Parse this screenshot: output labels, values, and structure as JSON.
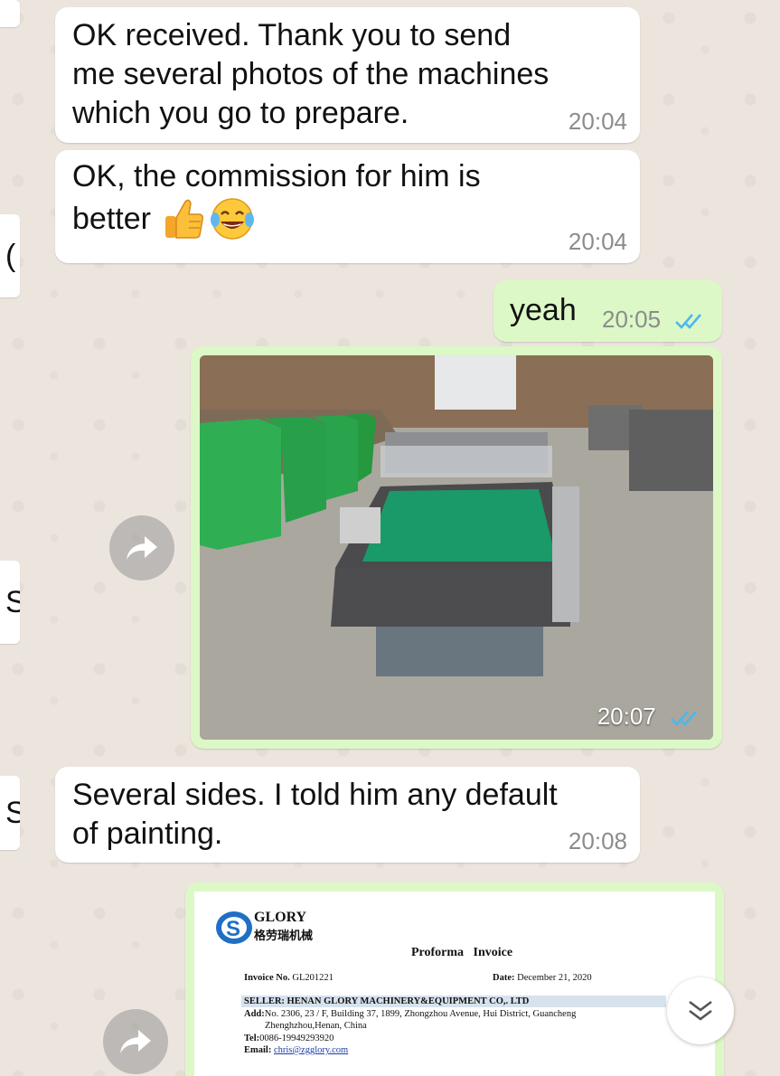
{
  "messages": [
    {
      "text_lines": [
        "OK received. Thank you to send",
        "me several photos of the machines",
        "which you go to prepare."
      ],
      "time": "20:04"
    },
    {
      "text_lines": [
        "OK, the commission for him is",
        "better"
      ],
      "time": "20:04",
      "emojis": [
        "thumbs-up",
        "tears-of-joy"
      ]
    },
    {
      "text": "yeah",
      "time": "20:05",
      "status": "read"
    },
    {
      "photo_alt": "Machine with green conveyor belt in factory",
      "time": "20:07",
      "status": "read"
    },
    {
      "text_lines": [
        "Several sides. I told him any default",
        "of painting."
      ],
      "time": "20:08"
    }
  ],
  "edge_tabs": [
    "(",
    "S",
    "S"
  ],
  "invoice": {
    "brand_en": "GLORY",
    "brand_cn": "格劳瑞机械",
    "title": "Proforma   Invoice",
    "invoice_no_label": "Invoice No.",
    "invoice_no": "GL201221",
    "date_label": "Date:",
    "date": "December 21, 2020",
    "seller": "SELLER: HENAN GLORY MACHINERY&EQUIPMENT CO,. LTD",
    "add_label": "Add:",
    "address_1": "No. 2306, 23 / F, Building 37, 1899, Zhongzhou Avenue, Hui District, Guancheng",
    "address_2": "Zhenghzhou,Henan, China",
    "tel_label": "Tel:",
    "tel": "0086-19949293920",
    "email_label": "Email:",
    "email": "chris@zgglory.com"
  },
  "colors": {
    "incoming": "#FFFFFF",
    "outgoing": "#DCF8C6",
    "read_ticks": "#4FB6EC",
    "background": "#ECE5DD"
  },
  "icons": [
    "forward-icon",
    "double-check-icon",
    "chevron-down-icon"
  ]
}
